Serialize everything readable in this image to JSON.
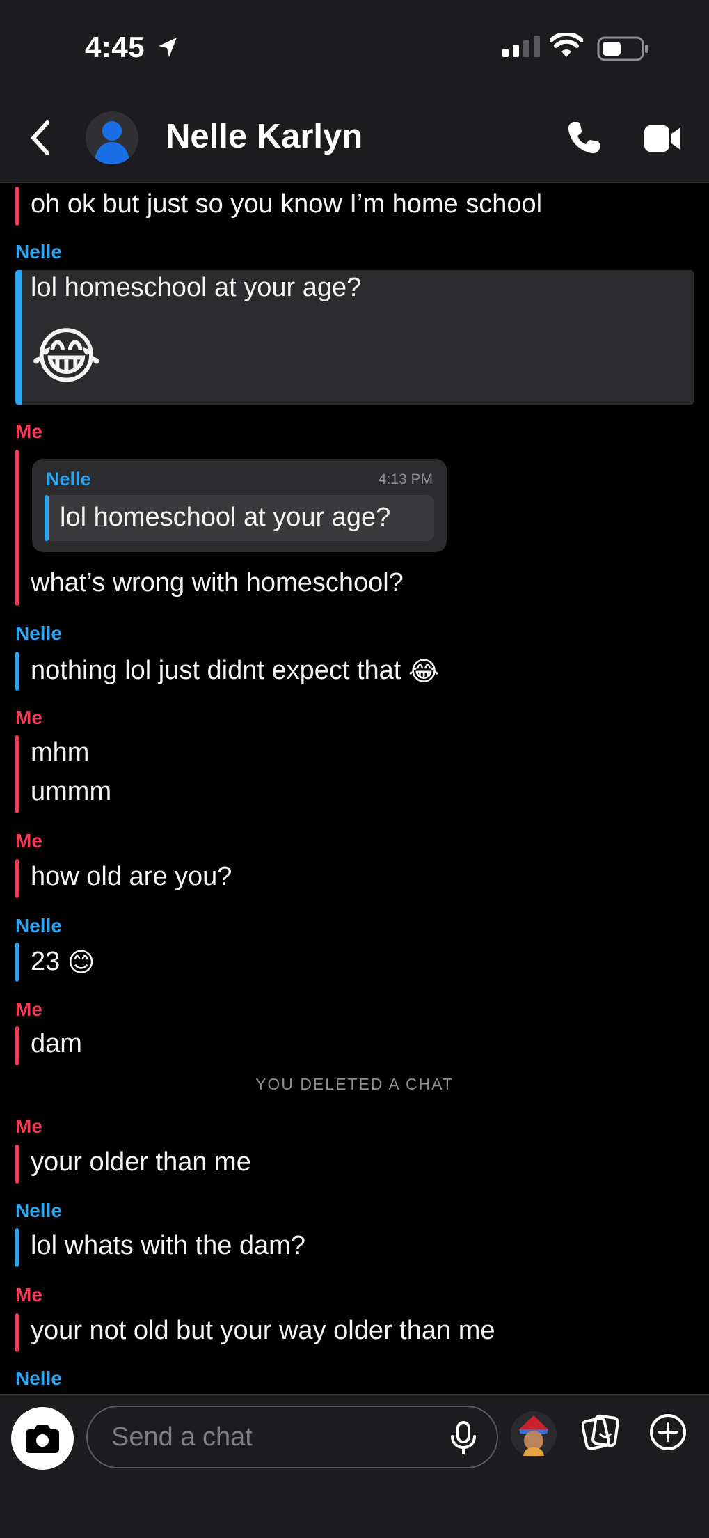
{
  "status_bar": {
    "time": "4:45"
  },
  "header": {
    "title": "Nelle Karlyn"
  },
  "conversation": {
    "first_line": "oh ok but just so you know I’m home school",
    "nelle_1_sender": "Nelle",
    "nelle_1_text": "lol homeschool at your age?",
    "nelle_1_emoji": "😂",
    "me_1_sender": "Me",
    "quote_sender": "Nelle",
    "quote_time": "4:13 PM",
    "quote_text": "lol homeschool at your age?",
    "me_1_text": "what’s wrong with homeschool?",
    "nelle_2_sender": "Nelle",
    "nelle_2_text": "nothing lol just didnt expect that",
    "nelle_2_emoji": "😂",
    "me_2_sender": "Me",
    "me_2_line1": "mhm",
    "me_2_line2": "ummm",
    "me_3_sender": "Me",
    "me_3_text": "how old are you?",
    "nelle_3_sender": "Nelle",
    "nelle_3_text": "23",
    "nelle_3_emoji": "😊",
    "me_4_sender": "Me",
    "me_4_text": "dam",
    "system_notice": "YOU DELETED A CHAT",
    "me_5_sender": "Me",
    "me_5_text": "your older than me",
    "nelle_4_sender": "Nelle",
    "nelle_4_text": "lol whats with the dam?",
    "me_6_sender": "Me",
    "me_6_text": "your not old but your way older than me",
    "nelle_5_sender": "Nelle"
  },
  "composer": {
    "placeholder": "Send a chat"
  },
  "colors": {
    "me": "#f23c57",
    "nelle": "#2ea5f0",
    "background": "#000000",
    "bar": "#1c1c1e"
  }
}
